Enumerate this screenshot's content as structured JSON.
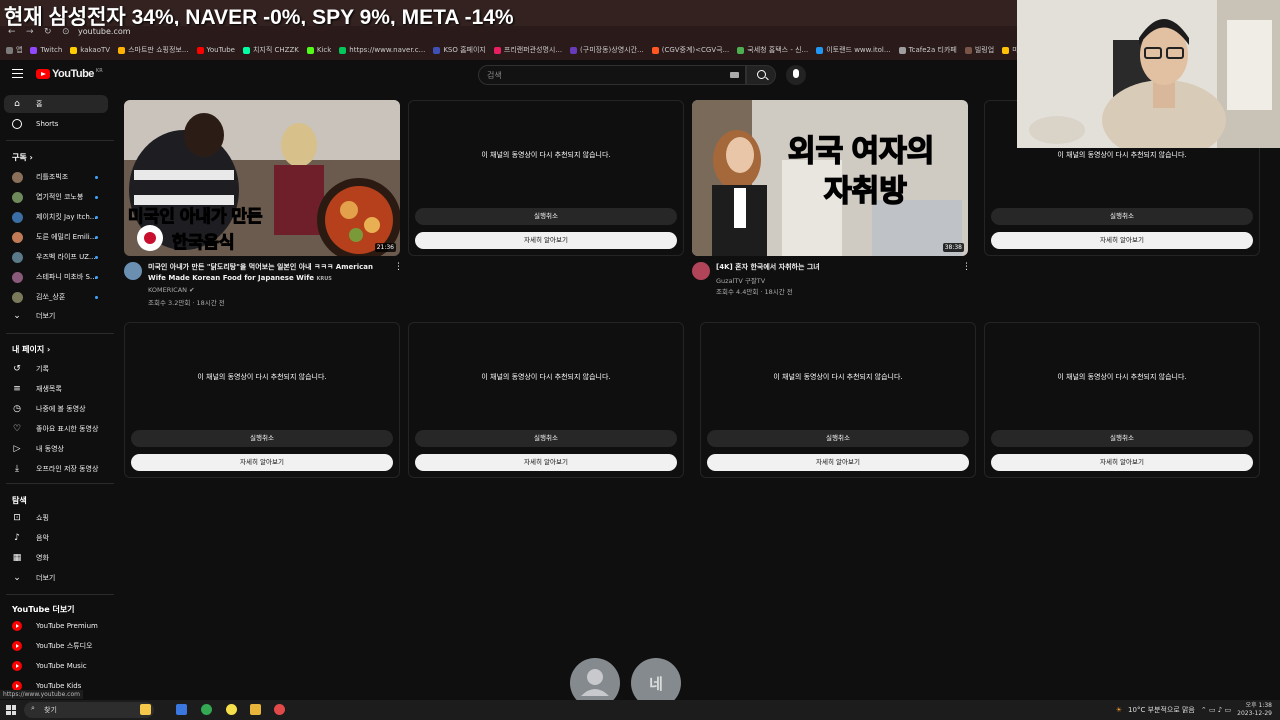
{
  "ticker": {
    "text": "현재 삼성전자 34%, NAVER -0%, SPY 9%, META -14%"
  },
  "browser": {
    "url": "youtube.com",
    "bookmarks": [
      "앱",
      "Twitch",
      "kakaoTV",
      "스마트판 쇼핑정보...",
      "YouTube",
      "치지직 CHZZK",
      "Kick",
      "https://www.naver.c...",
      "KSO 홈페이지",
      "프리랜퍼관성명시...",
      "(구미장동)상영시간...",
      "(CGV중계)<CGV극...",
      "국세청 홈택스 - 신...",
      "이토랜드 www.itol...",
      "Tcafe2a 티카페",
      "빌링업",
      "마니토거 - 회원인..."
    ]
  },
  "header": {
    "logo_text": "YouTube",
    "logo_region": "KR",
    "search_placeholder": "검색"
  },
  "sidebar": {
    "home": "홈",
    "shorts": "Shorts",
    "subs_heading": "구독",
    "subs": [
      "리틀조빅조",
      "엽기적인 코노봉",
      "제이치킷 Jay Itch...",
      "도른 에밀리 Emili...",
      "우즈벡 라이프 UZ...",
      "스테파니 미초바 S...",
      "김쏘_상훈"
    ],
    "subs_more": "더보기",
    "me_heading": "내 페이지",
    "me": [
      "기록",
      "재생목록",
      "나중에 볼 동영상",
      "좋아요 표시한 동영상",
      "내 동영상",
      "오프라인 저장 동영상"
    ],
    "explore_heading": "탐색",
    "explore": [
      "쇼핑",
      "음악",
      "영화",
      "더보기"
    ],
    "more_heading": "YouTube 더보기",
    "more": [
      "YouTube Premium",
      "YouTube 스튜디오",
      "YouTube Music",
      "YouTube Kids"
    ],
    "status_url": "https://www.youtube.com"
  },
  "removed": {
    "message": "이 채널의 동영상이 다시 추천되지 않습니다.",
    "undo": "실행취소",
    "learn_more": "자세히 알아보기"
  },
  "videos": [
    {
      "thumb_text_1": "미국인 아내가 만든",
      "thumb_text_2": "한국음식",
      "duration": "21:36",
      "title": "미국인 아내가 만든 \"닭도리탕\"을 먹어보는 일본인 아내 ㅋㅋㅋ American Wife Made Korean Food for Japanese Wife",
      "title_suffix": "KRUS",
      "channel": "KOMERICAN ✔",
      "meta": "조회수 3.2만회 · 18시간 전"
    },
    {
      "thumb_text_1": "외국 여자의",
      "thumb_text_2": "자취방",
      "duration": "38:38",
      "title": "[4K] 혼자 한국에서 자취하는 그녀",
      "title_suffix": "",
      "channel": "GuzalTV 구잘TV",
      "meta": "조회수 4.4만회 · 18시간 전"
    }
  ],
  "bottom": {
    "button_text": "네"
  },
  "taskbar": {
    "search": "찾기",
    "weather": "10°C 부분적으로 맑음",
    "time": "오후 1:38",
    "date": "2023-12-29"
  }
}
